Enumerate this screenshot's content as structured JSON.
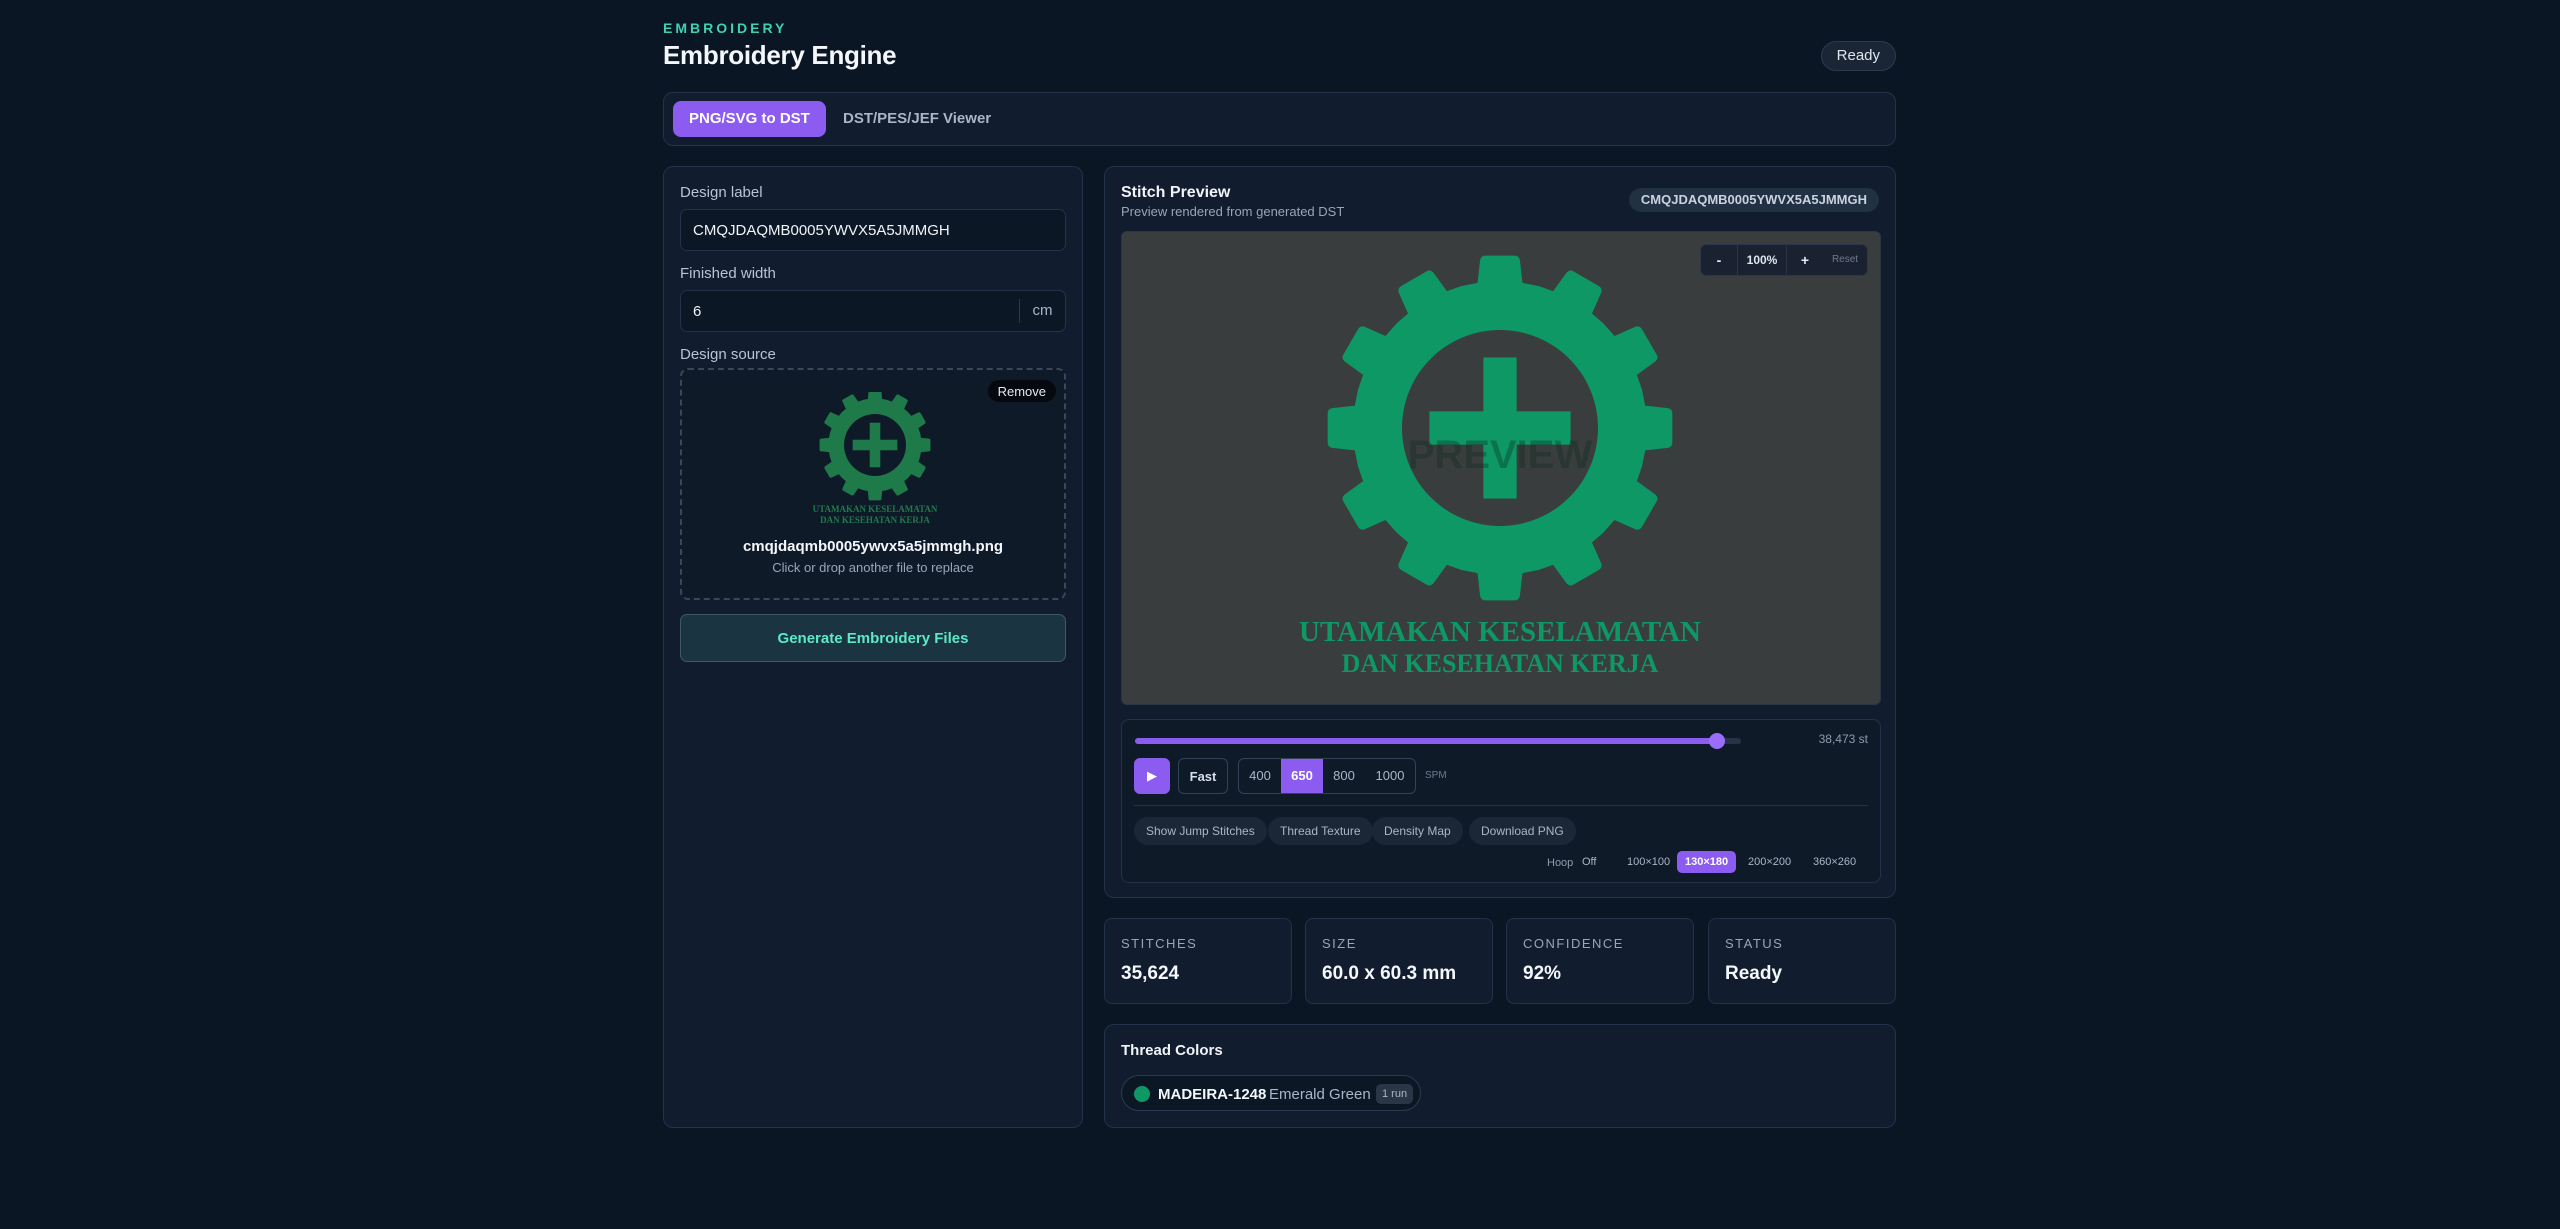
{
  "header": {
    "eyebrow": "EMBROIDERY",
    "title": "Embroidery Engine",
    "status_pill": "Ready"
  },
  "tabs": [
    {
      "label": "PNG/SVG to DST",
      "active": true
    },
    {
      "label": "DST/PES/JEF Viewer",
      "active": false
    }
  ],
  "form": {
    "design_label": {
      "label": "Design label",
      "value": "CMQJDAQMB0005YWVX5A5JMMGH"
    },
    "finished_width": {
      "label": "Finished width",
      "value": "6",
      "unit": "cm"
    },
    "design_source": {
      "label": "Design source",
      "remove_label": "Remove",
      "file_name": "cmqjdaqmb0005ywvx5a5jmmgh.png",
      "hint": "Click or drop another file to replace",
      "thumb_line1": "UTAMAKAN KESELAMATAN",
      "thumb_line2": "DAN KESEHATAN KERJA"
    },
    "generate_label": "Generate Embroidery Files"
  },
  "preview": {
    "title": "Stitch Preview",
    "subtitle": "Preview rendered from generated DST",
    "design_pill": "CMQJDAQMB0005YWVX5A5JMMGH",
    "watermark": "PREVIEW",
    "logo_line1": "UTAMAKAN KESELAMATAN",
    "logo_line2": "DAN KESEHATAN KERJA",
    "zoom": {
      "minus": "-",
      "value": "100%",
      "plus": "+",
      "reset": "Reset"
    },
    "progress_fraction": 0.96,
    "stitch_count": "38,473 st",
    "play_icon": "▶",
    "speed_fast": "Fast",
    "spm_options": [
      "400",
      "650",
      "800",
      "1000"
    ],
    "spm_selected": "650",
    "spm_unit": "SPM",
    "toggles": [
      "Show Jump Stitches",
      "Thread Texture",
      "Density Map",
      "Download PNG"
    ],
    "hoop": {
      "label": "Hoop",
      "options": [
        "Off",
        "100×100",
        "130×180",
        "200×200",
        "360×260"
      ],
      "selected": "130×180"
    }
  },
  "stats": [
    {
      "label": "STITCHES",
      "value": "35,624"
    },
    {
      "label": "SIZE",
      "value": "60.0 x 60.3 mm"
    },
    {
      "label": "CONFIDENCE",
      "value": "92%"
    },
    {
      "label": "STATUS",
      "value": "Ready"
    }
  ],
  "threads": {
    "title": "Thread Colors",
    "items": [
      {
        "code": "MADEIRA-1248",
        "name": "Emerald Green",
        "runs": "1 run",
        "color": "#0e9866"
      }
    ]
  },
  "colors": {
    "accent": "#8c5cf0",
    "teal": "#3fd1b0",
    "logo_green": "#0e9866",
    "thumb_green": "#1f7a4a"
  }
}
